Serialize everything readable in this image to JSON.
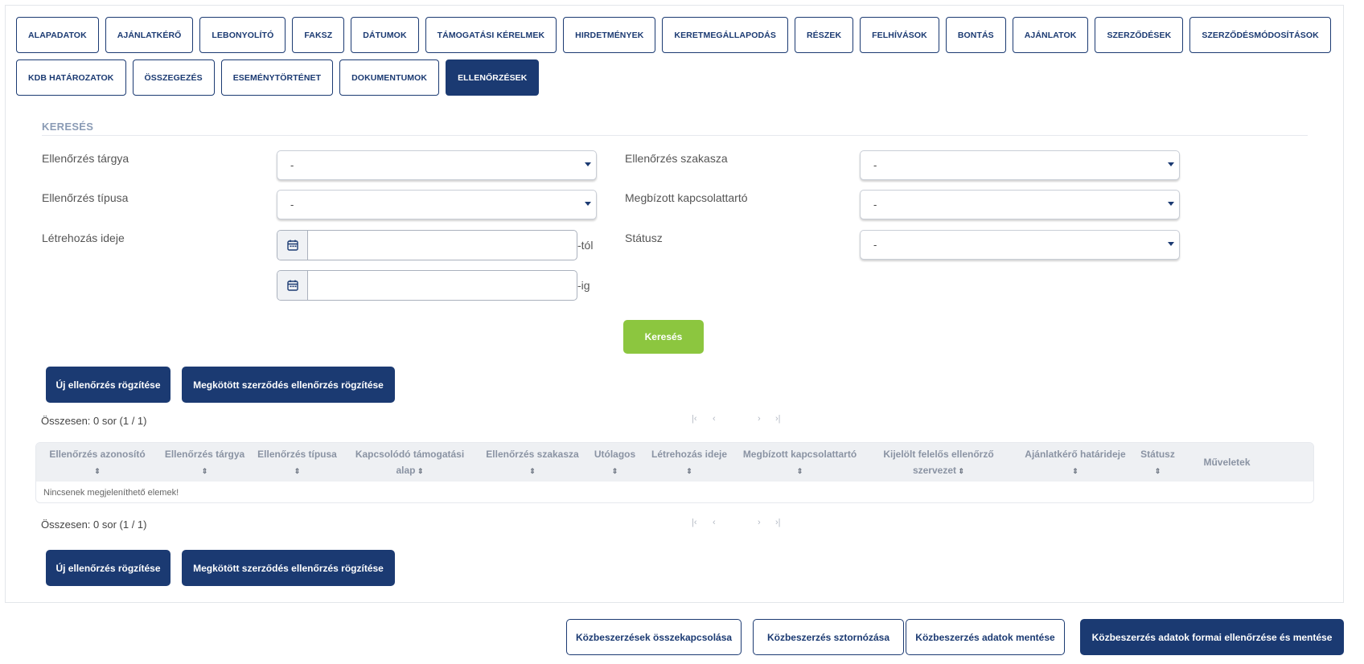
{
  "tabs": {
    "row1": [
      "ALAPADATOK",
      "AJÁNLATKÉRŐ",
      "LEBONYOLÍTÓ",
      "FAKSZ",
      "DÁTUMOK",
      "TÁMOGATÁSI KÉRELMEK",
      "HIRDETMÉNYEK",
      "KERETMEGÁLLAPODÁS",
      "RÉSZEK",
      "FELHÍVÁSOK",
      "BONTÁS",
      "AJÁNLATOK",
      "SZERZŐDÉSEK",
      "SZERZŐDÉSMÓDOSÍTÁSOK"
    ],
    "row2": [
      "KDB HATÁROZATOK",
      "ÖSSZEGEZÉS",
      "ESEMÉNYTÖRTÉNET",
      "DOKUMENTUMOK",
      "ELLENŐRZÉSEK"
    ],
    "active": "ELLENŐRZÉSEK"
  },
  "search": {
    "title": "KERESÉS",
    "fields": {
      "subject_label": "Ellenőrzés tárgya",
      "subject_value": "-",
      "type_label": "Ellenőrzés típusa",
      "type_value": "-",
      "created_label": "Létrehozás ideje",
      "from_suffix": "-tól",
      "to_suffix": "-ig",
      "phase_label": "Ellenőrzés szakasza",
      "phase_value": "-",
      "contact_label": "Megbízott kapcsolattartó",
      "contact_value": "-",
      "status_label": "Státusz",
      "status_value": "-"
    },
    "button": "Keresés"
  },
  "actions": {
    "new_check": "Új ellenőrzés rögzítése",
    "new_contract_check": "Megkötött szerződés ellenőrzés rögzítése"
  },
  "summary": {
    "total_text": "Összesen: 0 sor (1 / 1)"
  },
  "pager": {
    "first": "|‹",
    "prev": "‹",
    "next": "›",
    "last": "›|"
  },
  "table": {
    "columns": [
      {
        "line1": "Ellenőrzés azonosító",
        "line2": ""
      },
      {
        "line1": "Ellenőrzés tárgya",
        "line2": ""
      },
      {
        "line1": "Ellenőrzés típusa",
        "line2": ""
      },
      {
        "line1": "Kapcsolódó támogatási",
        "line2": "alap"
      },
      {
        "line1": "Ellenőrzés szakasza",
        "line2": ""
      },
      {
        "line1": "Utólagos",
        "line2": ""
      },
      {
        "line1": "Létrehozás ideje",
        "line2": ""
      },
      {
        "line1": "Megbízott kapcsolattartó",
        "line2": ""
      },
      {
        "line1": "Kijelölt felelős ellenőrző",
        "line2": "szervezet"
      },
      {
        "line1": "Ajánlatkérő határideje",
        "line2": ""
      },
      {
        "line1": "Státusz",
        "line2": ""
      },
      {
        "line1": "Műveletek",
        "line2": ""
      }
    ],
    "empty_text": "Nincsenek megjeleníthető elemek!"
  },
  "footer": {
    "link_button": "Közbeszerzések összekapcsolása",
    "cancel_button": "Közbeszerzés sztornózása",
    "save_button": "Közbeszerzés adatok mentése",
    "check_save_button": "Közbeszerzés adatok formai ellenőrzése és mentése"
  },
  "colors": {
    "primary": "#1b3a72",
    "accent_green": "#8cc63f",
    "section_title": "#8a9bb5"
  }
}
